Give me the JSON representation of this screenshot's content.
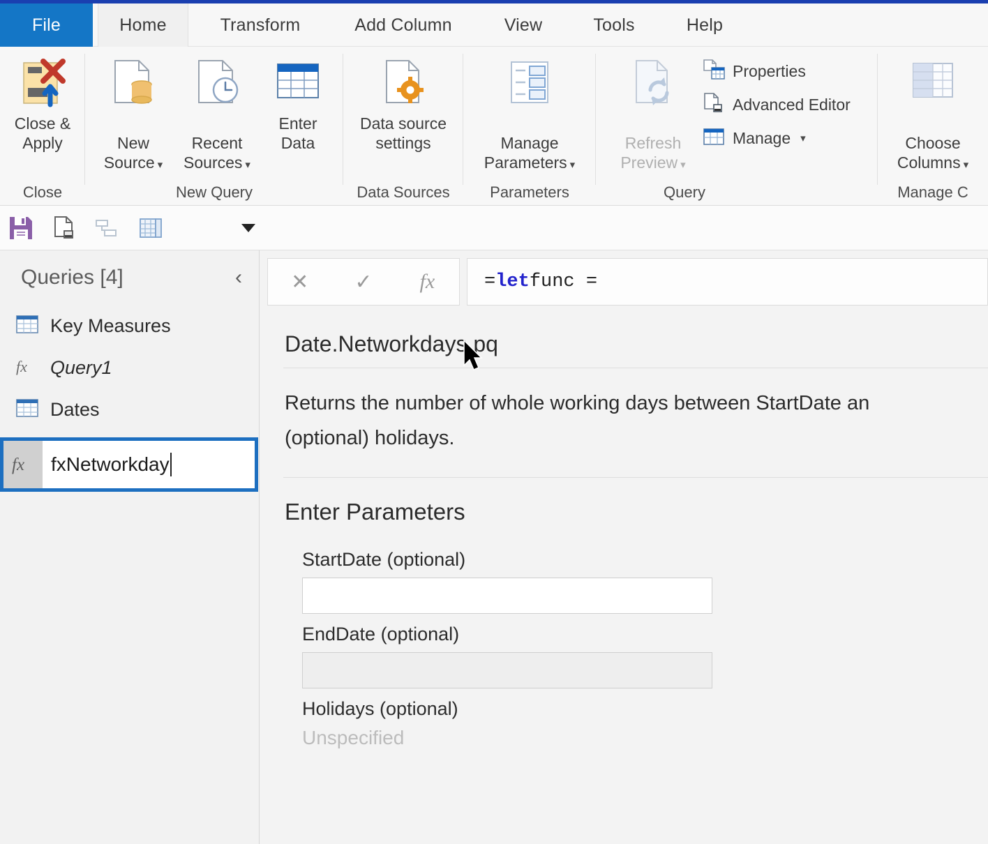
{
  "window": {
    "accent_blue": "#1a3fb0",
    "file_tab_blue": "#1476c6",
    "selection_blue": "#1d6fc0"
  },
  "tabs": [
    {
      "label": "File",
      "id": "file",
      "active": false
    },
    {
      "label": "Home",
      "id": "home",
      "active": true
    },
    {
      "label": "Transform",
      "id": "transform",
      "active": false
    },
    {
      "label": "Add Column",
      "id": "add-column",
      "active": false
    },
    {
      "label": "View",
      "id": "view",
      "active": false
    },
    {
      "label": "Tools",
      "id": "tools",
      "active": false
    },
    {
      "label": "Help",
      "id": "help",
      "active": false
    }
  ],
  "ribbon": {
    "groups": [
      {
        "name": "close",
        "label": "Close",
        "buttons": [
          {
            "name": "close-and-apply",
            "label": "Close &\nApply",
            "caret": true,
            "disabled": false
          }
        ]
      },
      {
        "name": "new-query",
        "label": "New Query",
        "buttons": [
          {
            "name": "new-source",
            "label": "New\nSource",
            "caret": true,
            "disabled": false
          },
          {
            "name": "recent-sources",
            "label": "Recent\nSources",
            "caret": true,
            "disabled": false
          },
          {
            "name": "enter-data",
            "label": "Enter\nData",
            "caret": false,
            "disabled": false
          }
        ]
      },
      {
        "name": "data-sources",
        "label": "Data Sources",
        "buttons": [
          {
            "name": "data-source-settings",
            "label": "Data source\nsettings",
            "caret": false,
            "disabled": false
          }
        ]
      },
      {
        "name": "parameters",
        "label": "Parameters",
        "buttons": [
          {
            "name": "manage-parameters",
            "label": "Manage\nParameters",
            "caret": true,
            "disabled": false
          }
        ]
      },
      {
        "name": "query",
        "label": "Query",
        "buttons": [
          {
            "name": "refresh-preview",
            "label": "Refresh\nPreview",
            "caret": true,
            "disabled": true
          }
        ],
        "small_buttons": [
          {
            "name": "properties",
            "label": "Properties",
            "caret": false
          },
          {
            "name": "advanced-editor",
            "label": "Advanced Editor",
            "caret": false
          },
          {
            "name": "manage",
            "label": "Manage",
            "caret": true
          }
        ]
      },
      {
        "name": "manage-columns",
        "label": "Manage C",
        "buttons": [
          {
            "name": "choose-columns",
            "label": "Choose\nColumns",
            "caret": true,
            "disabled": false
          }
        ]
      }
    ]
  },
  "quick_access": {
    "items": [
      {
        "name": "save-icon",
        "label": "Save"
      },
      {
        "name": "new-source-icon",
        "label": "New Source"
      },
      {
        "name": "merge-queries-icon",
        "label": "Merge Queries"
      },
      {
        "name": "append-queries-icon",
        "label": "Append Queries"
      }
    ],
    "overflow_label": "Customize Quick Access Toolbar"
  },
  "sidebar": {
    "title": "Queries [4]",
    "collapse_icon": "chevron-left-icon",
    "items": [
      {
        "name": "key-measures",
        "label": "Key Measures",
        "icon": "table-icon",
        "italic": false,
        "editing": false
      },
      {
        "name": "query1",
        "label": "Query1",
        "icon": "fx-icon",
        "italic": true,
        "editing": false
      },
      {
        "name": "dates",
        "label": "Dates",
        "icon": "table-icon",
        "italic": false,
        "editing": false
      },
      {
        "name": "fxnetworkday",
        "label": "fxNetworkday",
        "icon": "fx-icon",
        "italic": false,
        "editing": true
      }
    ],
    "rename_value": "fxNetworkday"
  },
  "formula_bar": {
    "cancel_icon": "close-icon",
    "accept_icon": "check-icon",
    "fx_icon": "fx-icon",
    "prefix": "= ",
    "keyword": "let",
    "rest": " func ="
  },
  "content": {
    "doc_title": "Date.Networkdays.pq",
    "description": "Returns the number of whole working days between StartDate an",
    "description_line2": "(optional) holidays.",
    "parameters_heading": "Enter Parameters",
    "parameters": [
      {
        "name": "start-date",
        "label": "StartDate (optional)",
        "value": "",
        "placeholder": "",
        "state": "active"
      },
      {
        "name": "end-date",
        "label": "EndDate (optional)",
        "value": "",
        "placeholder": "",
        "state": "inactive"
      },
      {
        "name": "holidays",
        "label": "Holidays (optional)",
        "value": "Unspecified",
        "placeholder": "Unspecified",
        "state": "unspecified"
      }
    ]
  }
}
